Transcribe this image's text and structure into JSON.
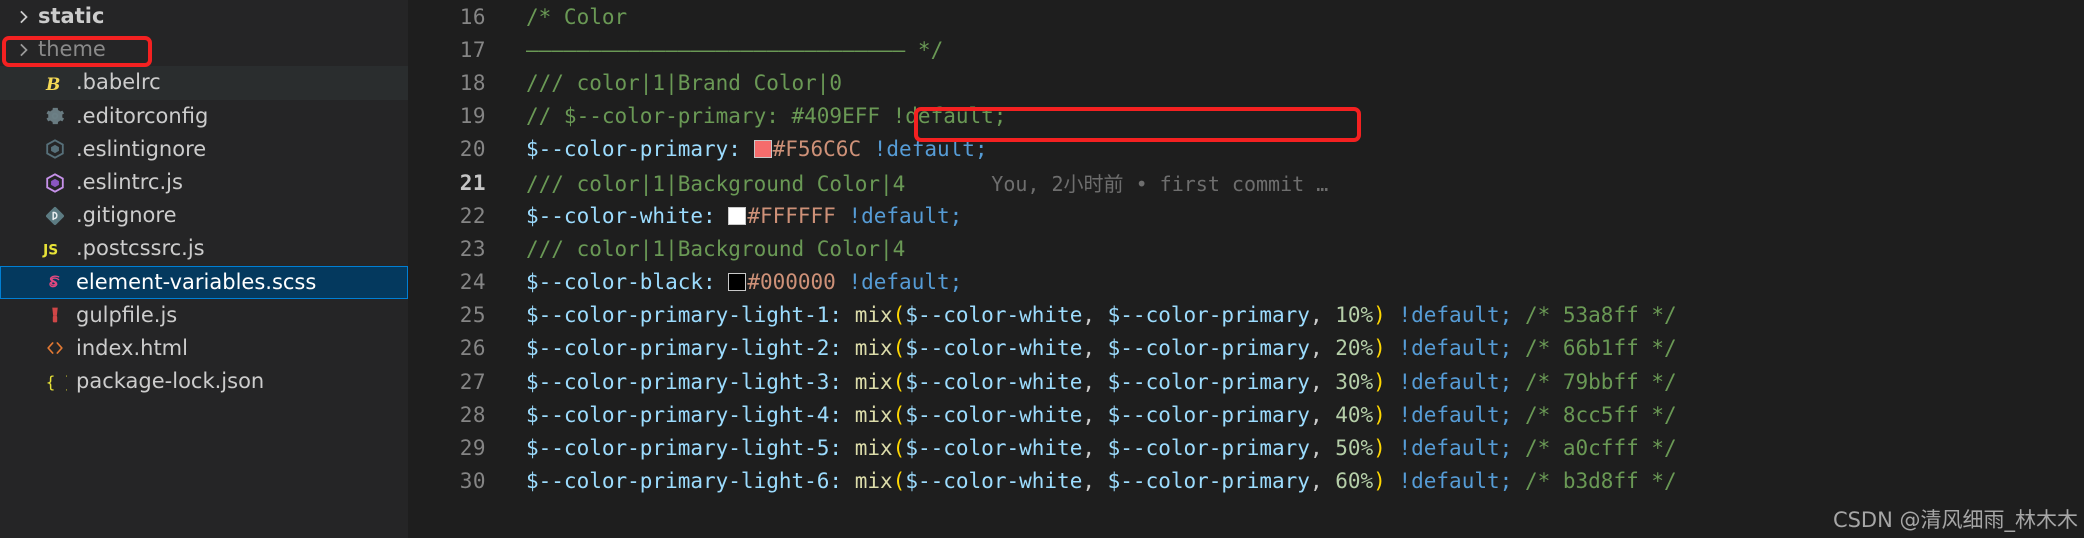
{
  "theme": {
    "editor_bg": "#1e1e1e",
    "sidebar_bg": "#252526",
    "selected_bg": "#04395e",
    "selected_border": "#007fd4",
    "hover_bg": "#2a2d2e",
    "highlight_red": "#f42121",
    "line_number_color": "#858585",
    "comment_green": "#6a9955",
    "variable_blue": "#9cdcfe",
    "keyword_blue": "#569cd6",
    "string_orange": "#ce9178",
    "function_yellow": "#dcdcaa",
    "number_green": "#b5cea8",
    "paren_gold": "#ffd700"
  },
  "sidebar": {
    "items": [
      {
        "label": "static",
        "kind": "folder",
        "icon": "chevron-right-icon",
        "state": "normal"
      },
      {
        "label": "theme",
        "kind": "folder",
        "icon": "chevron-right-icon",
        "state": "dim"
      },
      {
        "label": ".babelrc",
        "kind": "file",
        "icon": "babel-icon",
        "state": "hover"
      },
      {
        "label": ".editorconfig",
        "kind": "file",
        "icon": "editorconfig-icon",
        "state": "normal"
      },
      {
        "label": ".eslintignore",
        "kind": "file",
        "icon": "eslint-gray-icon",
        "state": "normal"
      },
      {
        "label": ".eslintrc.js",
        "kind": "file",
        "icon": "eslint-purple-icon",
        "state": "normal"
      },
      {
        "label": ".gitignore",
        "kind": "file",
        "icon": "git-icon",
        "state": "normal"
      },
      {
        "label": ".postcssrc.js",
        "kind": "file",
        "icon": "js-icon",
        "state": "normal"
      },
      {
        "label": "element-variables.scss",
        "kind": "file",
        "icon": "sass-icon",
        "state": "selected"
      },
      {
        "label": "gulpfile.js",
        "kind": "file",
        "icon": "gulp-icon",
        "state": "normal"
      },
      {
        "label": "index.html",
        "kind": "file",
        "icon": "html-icon",
        "state": "normal"
      },
      {
        "label": "package-lock.json",
        "kind": "file",
        "icon": "json-icon",
        "state": "normal"
      }
    ]
  },
  "editor": {
    "lines": [
      {
        "number": "16",
        "current": false
      },
      {
        "number": "17",
        "current": false
      },
      {
        "number": "18",
        "current": false
      },
      {
        "number": "19",
        "current": false
      },
      {
        "number": "20",
        "current": false
      },
      {
        "number": "21",
        "current": true
      },
      {
        "number": "22",
        "current": false
      },
      {
        "number": "23",
        "current": false
      },
      {
        "number": "24",
        "current": false
      },
      {
        "number": "25",
        "current": false
      },
      {
        "number": "26",
        "current": false
      },
      {
        "number": "27",
        "current": false
      },
      {
        "number": "28",
        "current": false
      },
      {
        "number": "29",
        "current": false
      },
      {
        "number": "30",
        "current": false
      }
    ],
    "code": {
      "l16_comment": "/* Color",
      "l17_rule": "–––––––––––––––––––––––––––––– */",
      "l18_comment": "/// color|1|Brand Color|0",
      "l19_comment": "// $--color-primary: #409EFF !default;",
      "l20_var": "$--color-primary:",
      "l20_hex": "#F56C6C",
      "l20_default": "!default",
      "l20_semi": ";",
      "l20_swatch_color": "#F56C6C",
      "l21_comment": "/// color|1|Background Color|4",
      "l22_var": "$--color-white:",
      "l22_hex": "#FFFFFF",
      "l22_default": "!default",
      "l22_semi": ";",
      "l22_swatch_color": "#FFFFFF",
      "l23_comment": "/// color|1|Background Color|4",
      "l24_var": "$--color-black:",
      "l24_hex": "#000000",
      "l24_default": "!default",
      "l24_semi": ";",
      "l24_swatch_color": "#000000",
      "mix_fn": "mix",
      "mix_arg1": "$--color-white",
      "mix_arg2": "$--color-primary",
      "default_kw": "!default",
      "light_rows": [
        {
          "name": "$--color-primary-light-1:",
          "pct": "10%",
          "comment": "/* 53a8ff */"
        },
        {
          "name": "$--color-primary-light-2:",
          "pct": "20%",
          "comment": "/* 66b1ff */"
        },
        {
          "name": "$--color-primary-light-3:",
          "pct": "30%",
          "comment": "/* 79bbff */"
        },
        {
          "name": "$--color-primary-light-4:",
          "pct": "40%",
          "comment": "/* 8cc5ff */"
        },
        {
          "name": "$--color-primary-light-5:",
          "pct": "50%",
          "comment": "/* a0cfff */"
        },
        {
          "name": "$--color-primary-light-6:",
          "pct": "60%",
          "comment": "/* b3d8ff */"
        }
      ]
    },
    "blame": "You, 2小时前 • first commit …"
  },
  "watermark": "CSDN @清风细雨_林木木"
}
